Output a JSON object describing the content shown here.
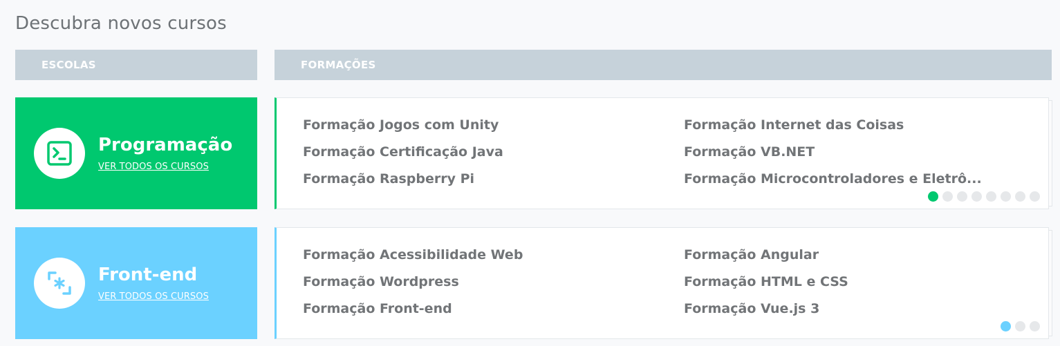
{
  "page": {
    "title": "Descubra novos cursos"
  },
  "headers": {
    "schools": "ESCOLAS",
    "formations": "FORMAÇÕES"
  },
  "colors": {
    "header_bg": "#c6d2da",
    "programacao": "#00c86f",
    "frontend": "#6bd1ff",
    "dot_inactive": "#e6e8ea",
    "formation_text": "#717477"
  },
  "schools": [
    {
      "name": "Programação",
      "link": "VER TODOS OS CURSOS",
      "icon": "terminal-icon",
      "color": "#00c86f",
      "formations": [
        "Formação Jogos com Unity",
        "Formação Certificação Java",
        "Formação Raspberry Pi",
        "Formação Internet das Coisas",
        "Formação VB.NET",
        "Formação Microcontroladores e Eletrô..."
      ],
      "pagination": {
        "current": 1,
        "total": 8
      }
    },
    {
      "name": "Front-end",
      "link": "VER TODOS OS CURSOS",
      "icon": "frontend-asterisk-icon",
      "color": "#6bd1ff",
      "formations": [
        "Formação Acessibilidade Web",
        "Formação Wordpress",
        "Formação Front-end",
        "Formação Angular",
        "Formação HTML e CSS",
        "Formação Vue.js 3"
      ],
      "pagination": {
        "current": 1,
        "total": 3
      }
    }
  ]
}
